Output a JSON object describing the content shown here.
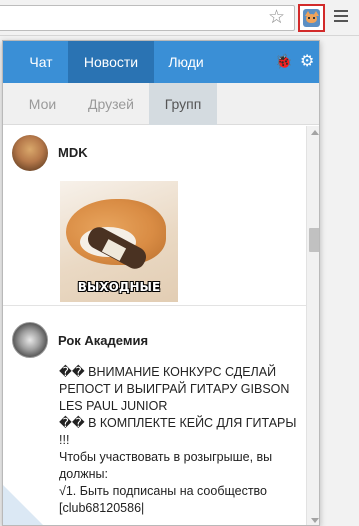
{
  "browser": {
    "star_icon": "star-icon",
    "extension_icon": "vk-dog-extension-icon",
    "menu_icon": "hamburger-menu-icon"
  },
  "tabs": [
    {
      "label": "Чат",
      "active": false
    },
    {
      "label": "Новости",
      "active": true
    },
    {
      "label": "Люди",
      "active": false
    }
  ],
  "header_icons": {
    "bug": "bug-icon",
    "gear": "gear-icon",
    "bug_glyph": "🐞",
    "gear_glyph": "⚙"
  },
  "subtabs": [
    {
      "label": "Мои",
      "active": false
    },
    {
      "label": "Друзей",
      "active": false
    },
    {
      "label": "Групп",
      "active": true
    }
  ],
  "posts": [
    {
      "author": "MDK",
      "image_caption": "ВЫХОДНЫЕ"
    },
    {
      "author": "Рок Академия",
      "text": "�� ВНИМАНИЕ КОНКУРС СДЕЛАЙ РЕПОСТ И ВЫИГРАЙ ГИТАРУ GIBSON LES PAUL JUNIOR\n�� В КОМПЛЕКТЕ КЕЙС ДЛЯ ГИТАРЫ !!!\nЧтобы участвовать в розыгрыше, вы должны:\n√1. Быть подписаны на сообщество [club68120586|"
    }
  ],
  "colors": {
    "tab_bar": "#3a8fd6",
    "tab_active": "#2a73b3",
    "extension_highlight": "#d22a2a"
  }
}
